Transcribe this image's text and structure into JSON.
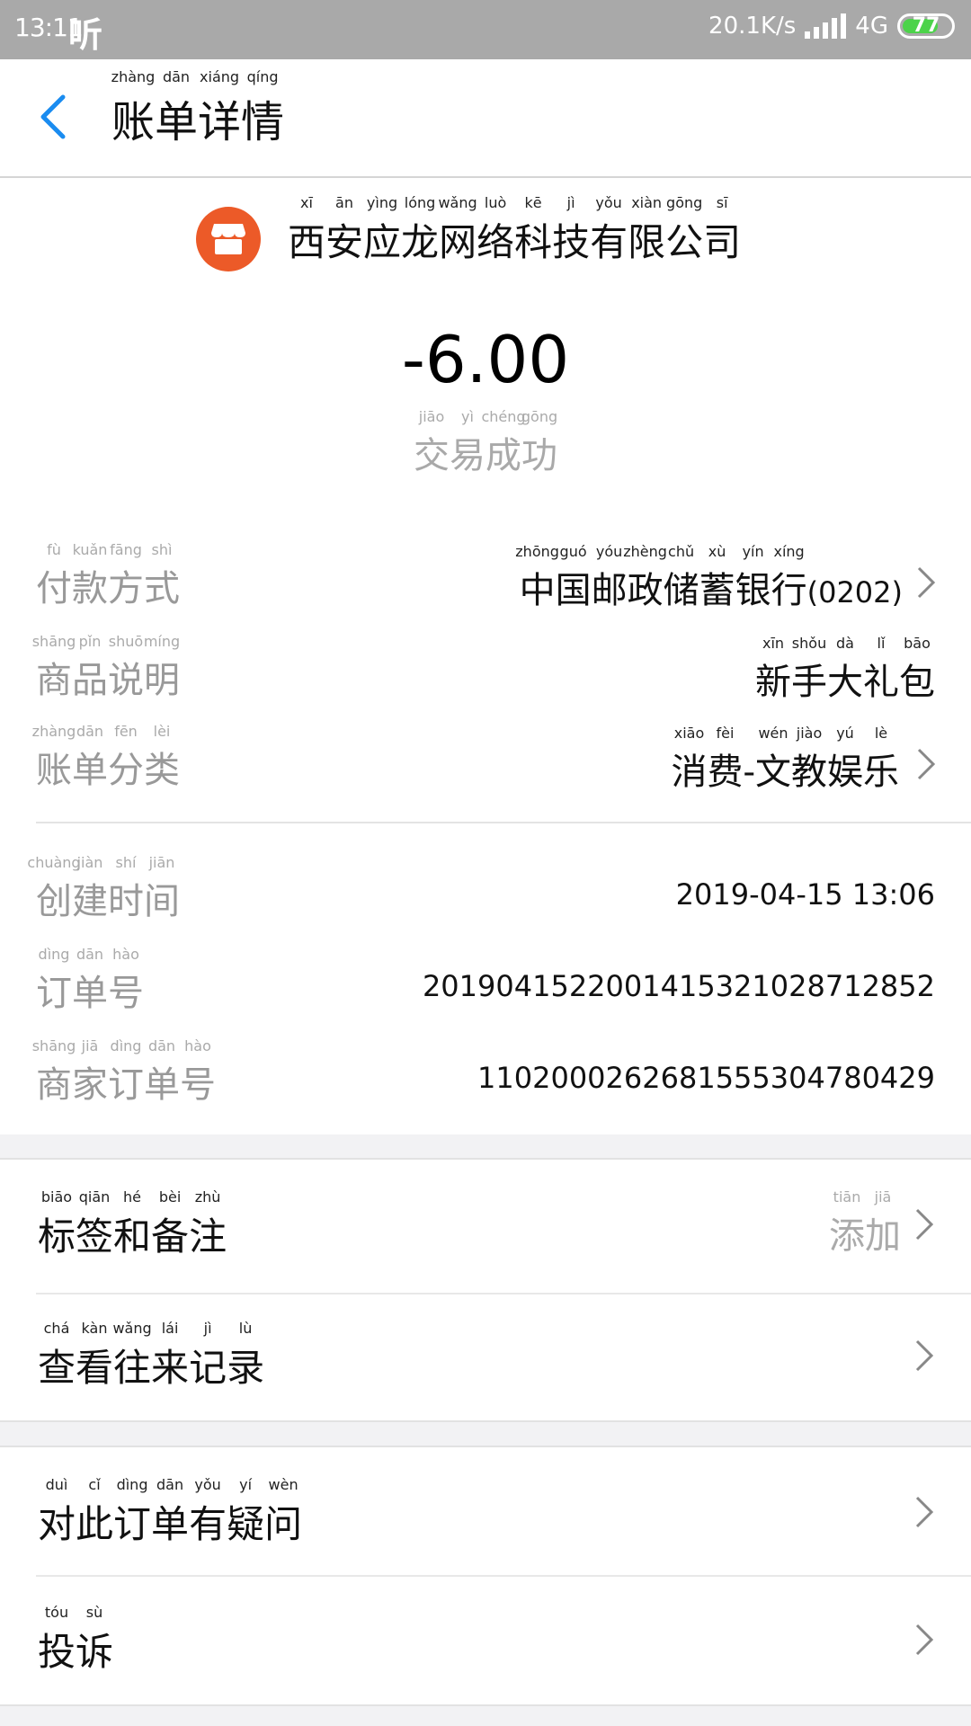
{
  "status_bar": {
    "time": "13:11",
    "listen_icon_text": "听",
    "net_speed": "20.1K/s",
    "network": "4G",
    "battery": "77",
    "battery_level_percent": 77
  },
  "header": {
    "title_chars": [
      {
        "char": "账",
        "py": "zhàng"
      },
      {
        "char": "单",
        "py": "dān"
      },
      {
        "char": "详",
        "py": "xiáng"
      },
      {
        "char": "情",
        "py": "qíng"
      }
    ]
  },
  "merchant": {
    "chars": [
      {
        "char": "西",
        "py": "xī"
      },
      {
        "char": "安",
        "py": "ān"
      },
      {
        "char": "应",
        "py": "yìng"
      },
      {
        "char": "龙",
        "py": "lóng"
      },
      {
        "char": "网",
        "py": "wǎng"
      },
      {
        "char": "络",
        "py": "luò"
      },
      {
        "char": "科",
        "py": "kē"
      },
      {
        "char": "技",
        "py": "jì"
      },
      {
        "char": "有",
        "py": "yǒu"
      },
      {
        "char": "限",
        "py": "xiàn"
      },
      {
        "char": "公",
        "py": "gōng"
      },
      {
        "char": "司",
        "py": "sī"
      }
    ]
  },
  "amount": "-6.00",
  "status_chars": [
    {
      "char": "交",
      "py": "jiāo"
    },
    {
      "char": "易",
      "py": "yì"
    },
    {
      "char": "成",
      "py": "chéng"
    },
    {
      "char": "功",
      "py": "gōng"
    }
  ],
  "details": [
    {
      "label": [
        {
          "char": "付",
          "py": "fù"
        },
        {
          "char": "款",
          "py": "kuǎn"
        },
        {
          "char": "方",
          "py": "fāng"
        },
        {
          "char": "式",
          "py": "shì"
        }
      ],
      "value": [
        {
          "char": "中",
          "py": "zhōng"
        },
        {
          "char": "国",
          "py": "guó"
        },
        {
          "char": "邮",
          "py": "yóu"
        },
        {
          "char": "政",
          "py": "zhèng"
        },
        {
          "char": "储",
          "py": "chǔ"
        },
        {
          "char": "蓄",
          "py": "xù"
        },
        {
          "char": "银",
          "py": "yín"
        },
        {
          "char": "行",
          "py": "xíng"
        }
      ],
      "value_suffix": "(0202)"
    },
    {
      "label": [
        {
          "char": "商",
          "py": "shāng"
        },
        {
          "char": "品",
          "py": "pǐn"
        },
        {
          "char": "说",
          "py": "shuō"
        },
        {
          "char": "明",
          "py": "míng"
        }
      ],
      "value": [
        {
          "char": "新",
          "py": "xīn"
        },
        {
          "char": "手",
          "py": "shǒu"
        },
        {
          "char": "大",
          "py": "dà"
        },
        {
          "char": "礼",
          "py": "lǐ"
        },
        {
          "char": "包",
          "py": "bāo"
        }
      ]
    },
    {
      "label": [
        {
          "char": "账",
          "py": "zhàng"
        },
        {
          "char": "单",
          "py": "dān"
        },
        {
          "char": "分",
          "py": "fēn"
        },
        {
          "char": "类",
          "py": "lèi"
        }
      ],
      "value": [
        {
          "char": "消",
          "py": "xiāo"
        },
        {
          "char": "费",
          "py": "fèi"
        },
        {
          "char": "-",
          "py": ""
        },
        {
          "char": "文",
          "py": "wén"
        },
        {
          "char": "教",
          "py": "jiào"
        },
        {
          "char": "娱",
          "py": "yú"
        },
        {
          "char": "乐",
          "py": "lè"
        }
      ]
    },
    {
      "label": [
        {
          "char": "创",
          "py": "chuàng"
        },
        {
          "char": "建",
          "py": "jiàn"
        },
        {
          "char": "时",
          "py": "shí"
        },
        {
          "char": "间",
          "py": "jiān"
        }
      ],
      "value_text": "2019-04-15  13:06"
    },
    {
      "label": [
        {
          "char": "订",
          "py": "dìng"
        },
        {
          "char": "单",
          "py": "dān"
        },
        {
          "char": "号",
          "py": "hào"
        }
      ],
      "value_text": "2019041522001415321028712852"
    },
    {
      "label": [
        {
          "char": "商",
          "py": "shāng"
        },
        {
          "char": "家",
          "py": "jiā"
        },
        {
          "char": "订",
          "py": "dìng"
        },
        {
          "char": "单",
          "py": "dān"
        },
        {
          "char": "号",
          "py": "hào"
        }
      ],
      "value_text": "1102000262681555304780429"
    }
  ],
  "actions": [
    {
      "label": [
        {
          "char": "标",
          "py": "biāo"
        },
        {
          "char": "签",
          "py": "qiān"
        },
        {
          "char": "和",
          "py": "hé"
        },
        {
          "char": "备",
          "py": "bèi"
        },
        {
          "char": "注",
          "py": "zhù"
        }
      ],
      "hint": [
        {
          "char": "添",
          "py": "tiān"
        },
        {
          "char": "加",
          "py": "jiā"
        }
      ]
    },
    {
      "label": [
        {
          "char": "查",
          "py": "chá"
        },
        {
          "char": "看",
          "py": "kàn"
        },
        {
          "char": "往",
          "py": "wǎng"
        },
        {
          "char": "来",
          "py": "lái"
        },
        {
          "char": "记",
          "py": "jì"
        },
        {
          "char": "录",
          "py": "lù"
        }
      ]
    },
    {
      "label": [
        {
          "char": "对",
          "py": "duì"
        },
        {
          "char": "此",
          "py": "cǐ"
        },
        {
          "char": "订",
          "py": "dìng"
        },
        {
          "char": "单",
          "py": "dān"
        },
        {
          "char": "有",
          "py": "yǒu"
        },
        {
          "char": "疑",
          "py": "yí"
        },
        {
          "char": "问",
          "py": "wèn"
        }
      ]
    },
    {
      "label": [
        {
          "char": "投",
          "py": "tóu"
        },
        {
          "char": "诉",
          "py": "sù"
        }
      ]
    }
  ],
  "colors": {
    "accent_blue": "#1a8cf0",
    "merchant_orange": "#ec5a28",
    "battery_green": "#4cd34a"
  }
}
